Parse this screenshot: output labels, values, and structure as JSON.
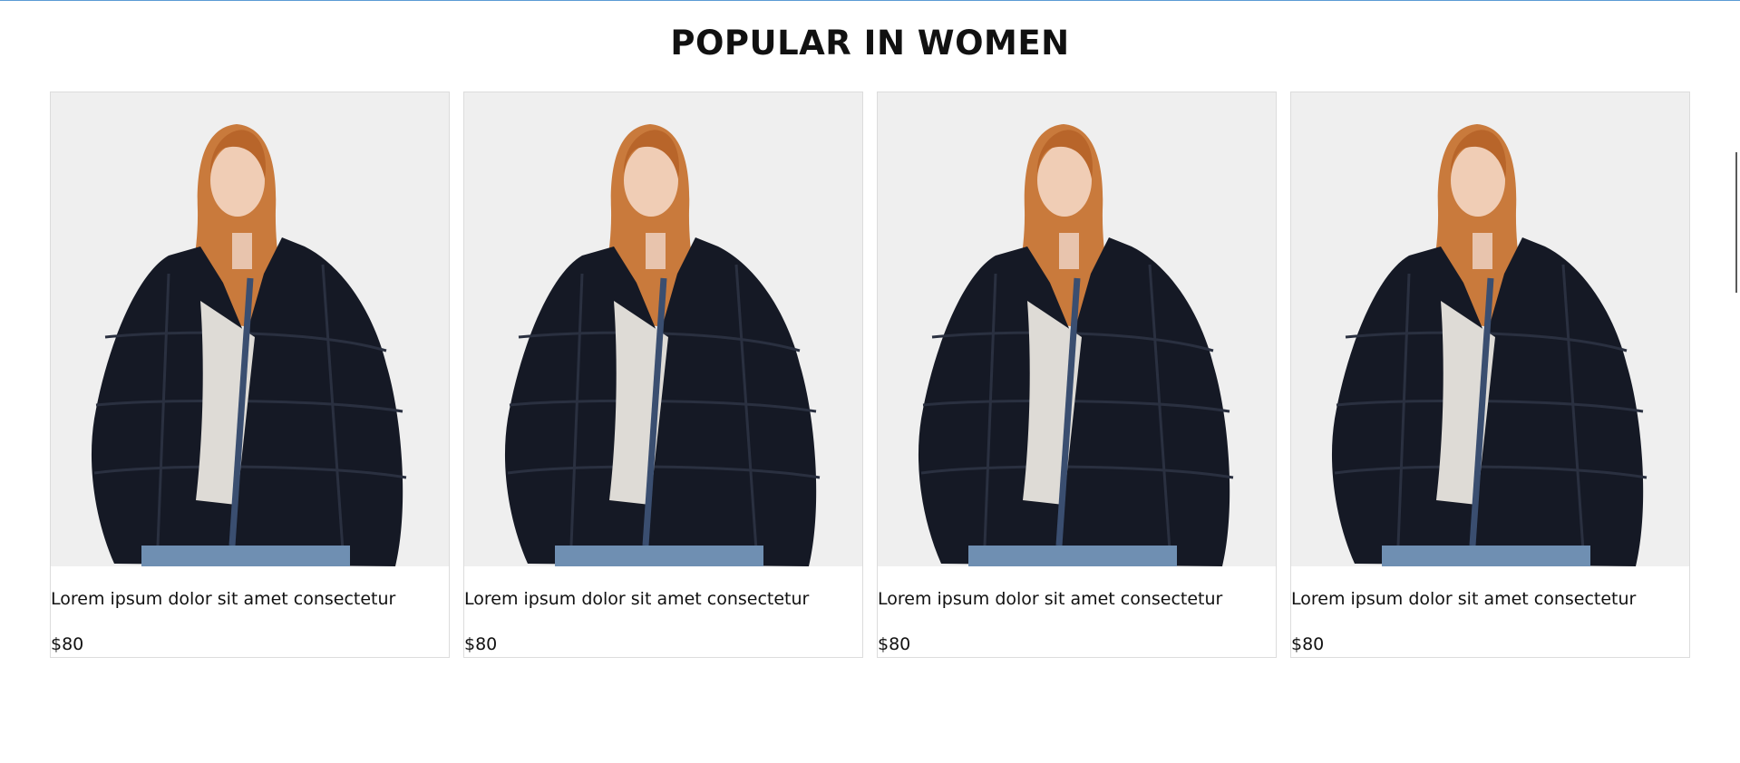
{
  "section": {
    "title": "POPULAR IN WOMEN"
  },
  "products": [
    {
      "title": "Lorem ipsum dolor sit amet consectetur",
      "price": "$80",
      "image_icon": "woman-fur-jacket-photo"
    },
    {
      "title": "Lorem ipsum dolor sit amet consectetur",
      "price": "$80",
      "image_icon": "woman-fur-jacket-photo"
    },
    {
      "title": "Lorem ipsum dolor sit amet consectetur",
      "price": "$80",
      "image_icon": "woman-fur-jacket-photo"
    },
    {
      "title": "Lorem ipsum dolor sit amet consectetur",
      "price": "$80",
      "image_icon": "woman-fur-jacket-photo"
    }
  ],
  "colors": {
    "accent_rule": "#5b9bd5",
    "card_border": "#dcdcdc",
    "photo_bg": "#efefef",
    "jacket": "#151925"
  }
}
